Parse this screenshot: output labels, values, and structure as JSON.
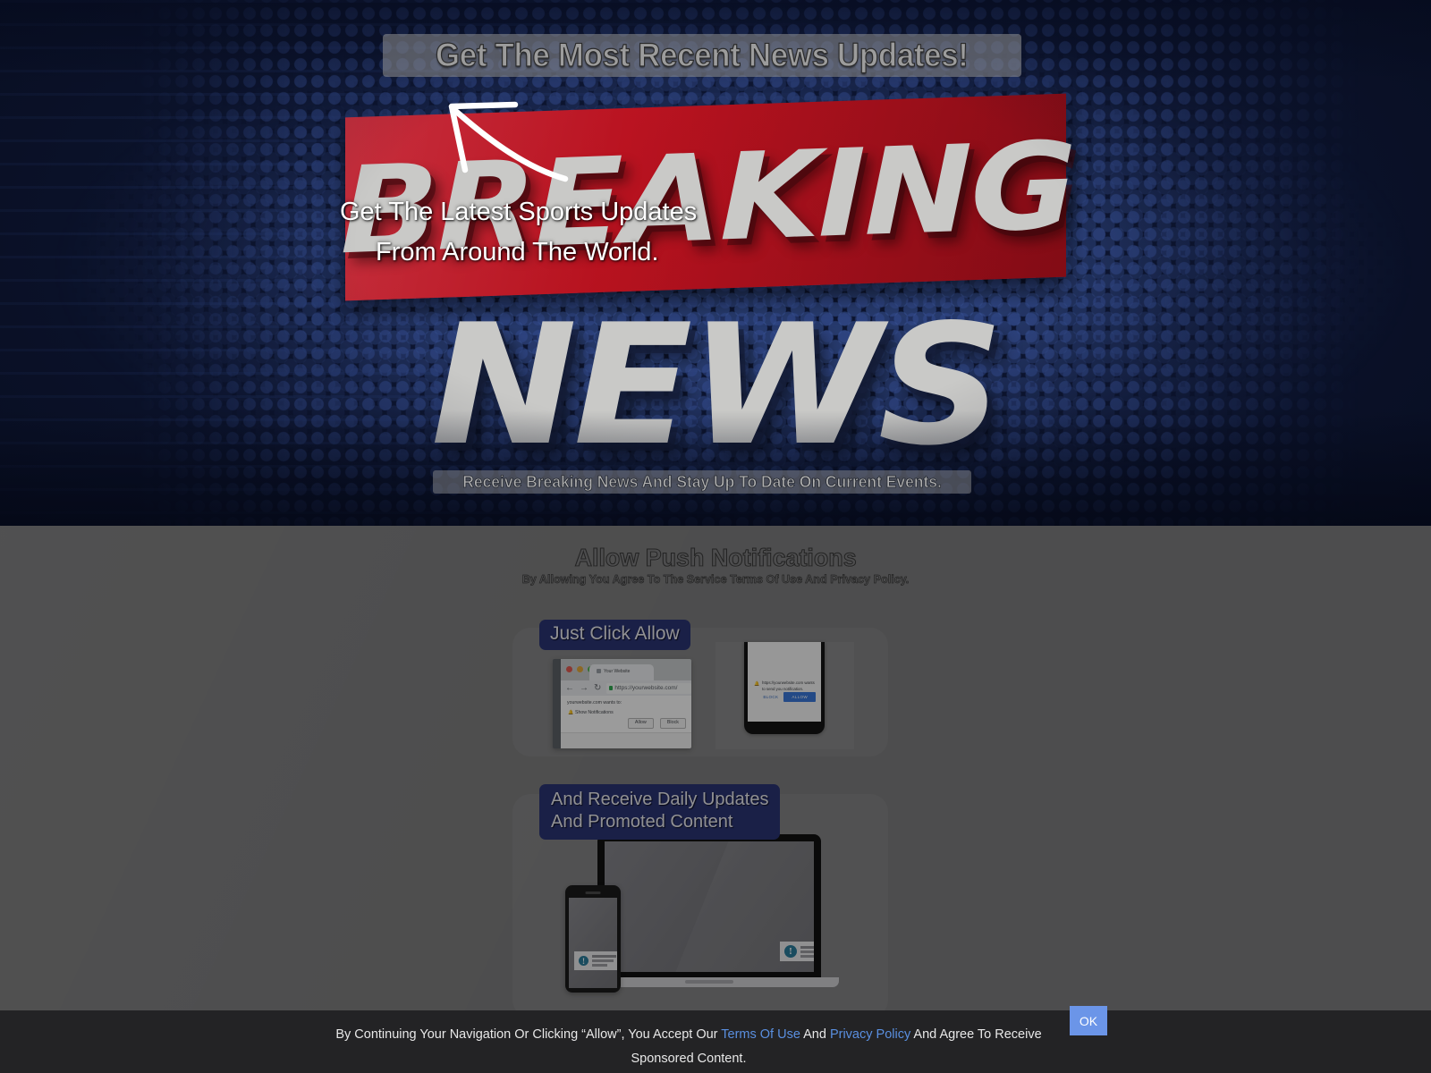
{
  "hero": {
    "headline": "Get The Most Recent News Updates!",
    "banner_word": "BREAKING",
    "banner_word2": "NEWS",
    "overlay_line1": "Get The Latest Sports Updates",
    "overlay_line2": "From Around The World.",
    "ticker": "Receive Breaking News And Stay Up To Date On Current Events.",
    "arrow_icon": "curved-arrow-up-left-icon",
    "colors": {
      "background": "#0d1530",
      "dots": "#3e5aa0",
      "banner_red": "#b8121f",
      "word_gray": "#c9c9c7"
    }
  },
  "push": {
    "title": "Allow Push Notifications",
    "subtitle": "By Allowing You Agree To The Service Terms Of Use And Privacy Policy.",
    "badge1": "Just Click Allow",
    "badge2_line1": "And Receive Daily Updates",
    "badge2_line2": "And Promoted Content",
    "badge_color": "#2b3473",
    "section_background": "#7d7d7e"
  },
  "browser_mock": {
    "tab_title": "Your Website",
    "url": "https://yourwebsite.com/",
    "prompt_line1": "yourwebsite.com wants to:",
    "prompt_line2": "Show Notifications",
    "allow_label": "Allow",
    "block_label": "Block",
    "back_icon": "arrow-left-icon",
    "forward_icon": "arrow-right-icon",
    "reload_icon": "reload-icon",
    "lock_icon": "lock-icon",
    "bell_icon": "bell-icon",
    "cursor_icon": "mouse-cursor-icon"
  },
  "phone_mock": {
    "prompt_line1": "https://yourwebsite.com wants to",
    "prompt_line2": "send you notification.",
    "block_label": "BLOCK",
    "allow_label": "ALLOW",
    "bell_icon": "bell-icon"
  },
  "devices_mock": {
    "laptop_icon": "laptop-icon",
    "phone_icon": "smartphone-icon",
    "toast_icon": "info-circle-icon",
    "toast_glyph": "!"
  },
  "consent": {
    "text_part1": "By Continuing Your Navigation Or Clicking “Allow”, You Accept Our ",
    "link1": "Terms Of Use",
    "text_part2": " And ",
    "link2": "Privacy Policy",
    "text_part3": " And Agree To Receive Sponsored Content.",
    "ok_label": "OK",
    "bar_color": "#232325",
    "link_color": "#5a8fe0",
    "ok_color": "#6b95e8"
  }
}
